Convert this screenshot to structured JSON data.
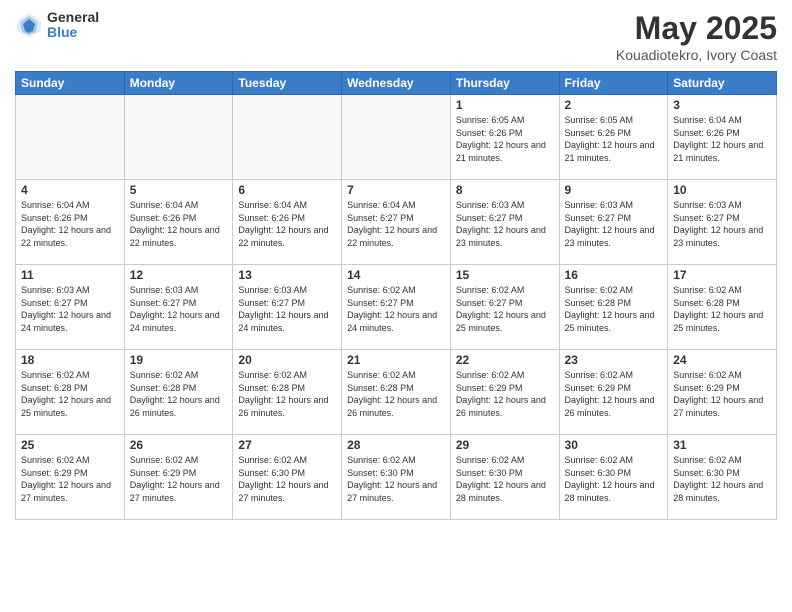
{
  "header": {
    "logo_general": "General",
    "logo_blue": "Blue",
    "title": "May 2025",
    "subtitle": "Kouadiotekro, Ivory Coast"
  },
  "days_of_week": [
    "Sunday",
    "Monday",
    "Tuesday",
    "Wednesday",
    "Thursday",
    "Friday",
    "Saturday"
  ],
  "weeks": [
    [
      {
        "day": "",
        "info": ""
      },
      {
        "day": "",
        "info": ""
      },
      {
        "day": "",
        "info": ""
      },
      {
        "day": "",
        "info": ""
      },
      {
        "day": "1",
        "info": "Sunrise: 6:05 AM\nSunset: 6:26 PM\nDaylight: 12 hours\nand 21 minutes."
      },
      {
        "day": "2",
        "info": "Sunrise: 6:05 AM\nSunset: 6:26 PM\nDaylight: 12 hours\nand 21 minutes."
      },
      {
        "day": "3",
        "info": "Sunrise: 6:04 AM\nSunset: 6:26 PM\nDaylight: 12 hours\nand 21 minutes."
      }
    ],
    [
      {
        "day": "4",
        "info": "Sunrise: 6:04 AM\nSunset: 6:26 PM\nDaylight: 12 hours\nand 22 minutes."
      },
      {
        "day": "5",
        "info": "Sunrise: 6:04 AM\nSunset: 6:26 PM\nDaylight: 12 hours\nand 22 minutes."
      },
      {
        "day": "6",
        "info": "Sunrise: 6:04 AM\nSunset: 6:26 PM\nDaylight: 12 hours\nand 22 minutes."
      },
      {
        "day": "7",
        "info": "Sunrise: 6:04 AM\nSunset: 6:27 PM\nDaylight: 12 hours\nand 22 minutes."
      },
      {
        "day": "8",
        "info": "Sunrise: 6:03 AM\nSunset: 6:27 PM\nDaylight: 12 hours\nand 23 minutes."
      },
      {
        "day": "9",
        "info": "Sunrise: 6:03 AM\nSunset: 6:27 PM\nDaylight: 12 hours\nand 23 minutes."
      },
      {
        "day": "10",
        "info": "Sunrise: 6:03 AM\nSunset: 6:27 PM\nDaylight: 12 hours\nand 23 minutes."
      }
    ],
    [
      {
        "day": "11",
        "info": "Sunrise: 6:03 AM\nSunset: 6:27 PM\nDaylight: 12 hours\nand 24 minutes."
      },
      {
        "day": "12",
        "info": "Sunrise: 6:03 AM\nSunset: 6:27 PM\nDaylight: 12 hours\nand 24 minutes."
      },
      {
        "day": "13",
        "info": "Sunrise: 6:03 AM\nSunset: 6:27 PM\nDaylight: 12 hours\nand 24 minutes."
      },
      {
        "day": "14",
        "info": "Sunrise: 6:02 AM\nSunset: 6:27 PM\nDaylight: 12 hours\nand 24 minutes."
      },
      {
        "day": "15",
        "info": "Sunrise: 6:02 AM\nSunset: 6:27 PM\nDaylight: 12 hours\nand 25 minutes."
      },
      {
        "day": "16",
        "info": "Sunrise: 6:02 AM\nSunset: 6:28 PM\nDaylight: 12 hours\nand 25 minutes."
      },
      {
        "day": "17",
        "info": "Sunrise: 6:02 AM\nSunset: 6:28 PM\nDaylight: 12 hours\nand 25 minutes."
      }
    ],
    [
      {
        "day": "18",
        "info": "Sunrise: 6:02 AM\nSunset: 6:28 PM\nDaylight: 12 hours\nand 25 minutes."
      },
      {
        "day": "19",
        "info": "Sunrise: 6:02 AM\nSunset: 6:28 PM\nDaylight: 12 hours\nand 26 minutes."
      },
      {
        "day": "20",
        "info": "Sunrise: 6:02 AM\nSunset: 6:28 PM\nDaylight: 12 hours\nand 26 minutes."
      },
      {
        "day": "21",
        "info": "Sunrise: 6:02 AM\nSunset: 6:28 PM\nDaylight: 12 hours\nand 26 minutes."
      },
      {
        "day": "22",
        "info": "Sunrise: 6:02 AM\nSunset: 6:29 PM\nDaylight: 12 hours\nand 26 minutes."
      },
      {
        "day": "23",
        "info": "Sunrise: 6:02 AM\nSunset: 6:29 PM\nDaylight: 12 hours\nand 26 minutes."
      },
      {
        "day": "24",
        "info": "Sunrise: 6:02 AM\nSunset: 6:29 PM\nDaylight: 12 hours\nand 27 minutes."
      }
    ],
    [
      {
        "day": "25",
        "info": "Sunrise: 6:02 AM\nSunset: 6:29 PM\nDaylight: 12 hours\nand 27 minutes."
      },
      {
        "day": "26",
        "info": "Sunrise: 6:02 AM\nSunset: 6:29 PM\nDaylight: 12 hours\nand 27 minutes."
      },
      {
        "day": "27",
        "info": "Sunrise: 6:02 AM\nSunset: 6:30 PM\nDaylight: 12 hours\nand 27 minutes."
      },
      {
        "day": "28",
        "info": "Sunrise: 6:02 AM\nSunset: 6:30 PM\nDaylight: 12 hours\nand 27 minutes."
      },
      {
        "day": "29",
        "info": "Sunrise: 6:02 AM\nSunset: 6:30 PM\nDaylight: 12 hours\nand 28 minutes."
      },
      {
        "day": "30",
        "info": "Sunrise: 6:02 AM\nSunset: 6:30 PM\nDaylight: 12 hours\nand 28 minutes."
      },
      {
        "day": "31",
        "info": "Sunrise: 6:02 AM\nSunset: 6:30 PM\nDaylight: 12 hours\nand 28 minutes."
      }
    ]
  ]
}
